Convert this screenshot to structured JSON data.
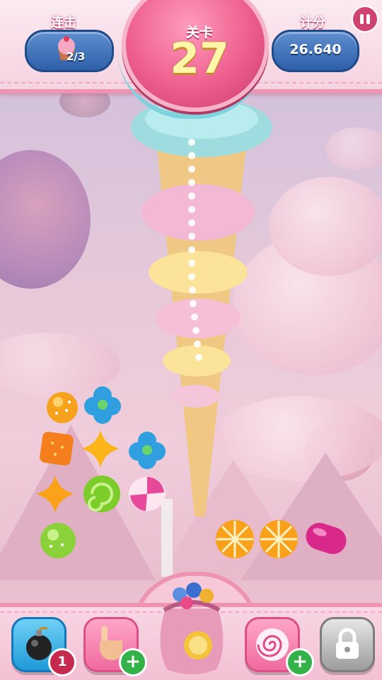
{
  "header": {
    "combo_label": "连击",
    "combo_value": "2/3",
    "level_label": "关卡",
    "level_number": "27",
    "score_label": "计分",
    "score_value": "26.640"
  },
  "toolbar": {
    "bomb_count": "1",
    "hand_plus": "+",
    "swirl_plus": "+"
  },
  "icons": [
    "pause-icon",
    "cupcake-icon",
    "bomb-icon",
    "hand-icon",
    "candy-bag-icon",
    "swirl-candy-icon",
    "lock-icon"
  ],
  "colors": {
    "accent": "#ee5f8e",
    "pill": "#2e5fa8",
    "plus": "#33b24a",
    "badge": "#c62a4e"
  }
}
